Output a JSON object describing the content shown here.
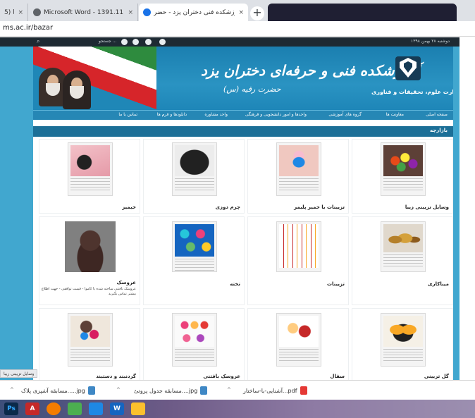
{
  "browser": {
    "tabs": [
      {
        "title": "5) با",
        "icon_color": "#e0e0e0"
      },
      {
        "title": "Microsoft Word - 1391.11.17",
        "icon_color": "#5f6368"
      },
      {
        "title": "آموزشکده فنی دختران یزد - حضر...",
        "icon_color": "#1a73e8"
      }
    ],
    "close_glyph": "×",
    "new_tab_glyph": "+",
    "url": "ms.ac.ir/bazar"
  },
  "site": {
    "topbar": {
      "search_placeholder": "جستجو ...",
      "login_text": "دوشنبه ۲۸ بهمن ۱۳۹۸"
    },
    "banner": {
      "title": "آموزشکده فنی و حرفه‌ای دختران یزد",
      "subtitle": "حضرت رقیه (س)",
      "ministry": "وزارت علوم، تحقیقات و فناوری"
    },
    "nav": [
      "صفحه اصلی",
      "معاونت ها",
      "گروه های آموزشی",
      "واحدها و امور دانشجویی و فرهنگی",
      "واحد مشاوره",
      "دانلودها و فرم ها",
      "تماس با ما"
    ],
    "section_title": "بازارچه",
    "products": [
      {
        "title": "وسایل تزیینی زیبا",
        "desc": ""
      },
      {
        "title": "تزیینات با خمیر پلیمر",
        "desc": ""
      },
      {
        "title": "چرم دوزی",
        "desc": ""
      },
      {
        "title": "خیمیز",
        "desc": ""
      },
      {
        "title": "میناکاری",
        "desc": ""
      },
      {
        "title": "تزیینات",
        "desc": ""
      },
      {
        "title": "تخته",
        "desc": ""
      },
      {
        "title": "عروسک",
        "desc": "عروسک بافتنی ساخته شده با کاموا - قیمت توافقی - جهت اطلاع بیشتر تماس بگیرید"
      },
      {
        "title": "گل تزیینی",
        "desc": ""
      },
      {
        "title": "سفال",
        "desc": ""
      },
      {
        "title": "عروسک بافتنی",
        "desc": ""
      },
      {
        "title": "گردنبند و دستبند",
        "desc": ""
      }
    ]
  },
  "status_tip": "وسایل تزیینی زیبا",
  "downloads": [
    {
      "name": "pdf...آشنایی-با-ساختار",
      "icon_color": "#e53935"
    },
    {
      "name": "jpg....مسابقه جدول پروتئ",
      "icon_color": "#3f88c5"
    },
    {
      "name": "jpg.....مسابقه آشپزی پلاک",
      "icon_color": "#3f88c5"
    }
  ],
  "download_chevron": "^",
  "taskbar": [
    {
      "label": "Ps",
      "color": "#0b2a4a"
    },
    {
      "label": "A",
      "color": "#c62828"
    },
    {
      "label": "",
      "color": "#f57c00"
    },
    {
      "label": "",
      "color": "#4caf50"
    },
    {
      "label": "",
      "color": "#1e88e5"
    },
    {
      "label": "W",
      "color": "#1565c0"
    },
    {
      "label": "",
      "color": "#fbc02d"
    }
  ]
}
